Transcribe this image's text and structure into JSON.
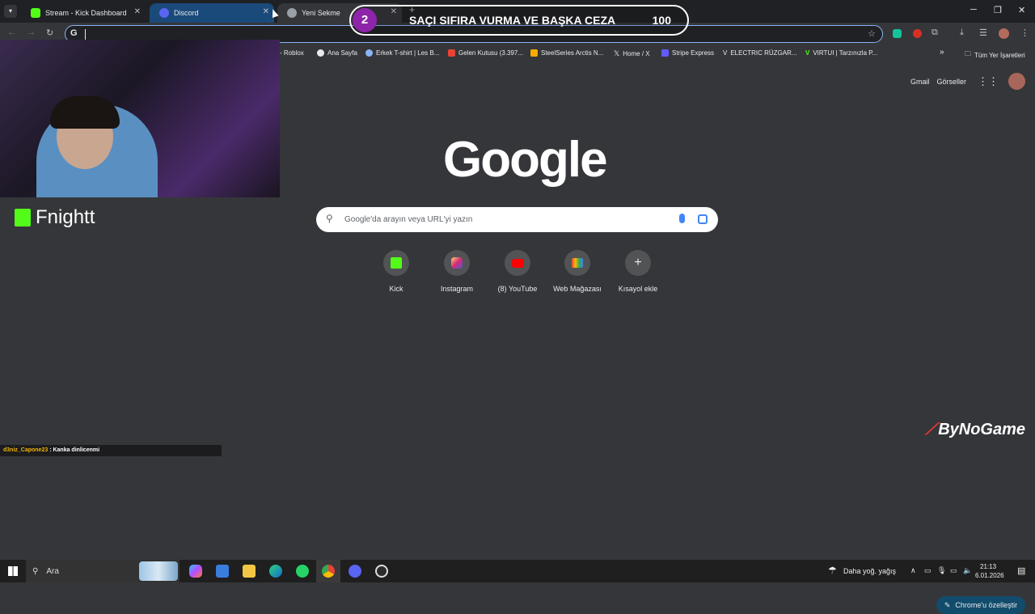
{
  "tabs": [
    {
      "label": "Stream - Kick Dashboard",
      "color": "#53fc18"
    },
    {
      "label": "Discord",
      "color": "#5865f2"
    },
    {
      "label": "Yeni Sekme",
      "color": "#9aa0a6"
    }
  ],
  "overlay": {
    "number": "2",
    "text": "SAÇI SIFIRA VURMA VE BAŞKA CEZA",
    "count": "100"
  },
  "bookmarks": [
    {
      "label": "- Roblox",
      "color": "#9aa0a6"
    },
    {
      "label": "Ana Sayfa",
      "color": "#e8eaed"
    },
    {
      "label": "Erkek T-shirt | Les B...",
      "color": "#8ab4f8"
    },
    {
      "label": "Gelen Kutusu (3.397...",
      "color": "#ea4335"
    },
    {
      "label": "SteelSeries Arctis N...",
      "color": "#f9ab00"
    },
    {
      "label": "Home / X",
      "color": "#ffffff"
    },
    {
      "label": "Stripe Express",
      "color": "#635bff"
    },
    {
      "label": "ELECTRIC RÜZGAR...",
      "color": "#000000"
    },
    {
      "label": "VIRTUI | Tarzınızla P...",
      "color": "#53fc18"
    }
  ],
  "all_bookmarks_label": "Tüm Yer İşaretleri",
  "top_links": {
    "gmail": "Gmail",
    "images": "Görseller"
  },
  "logo_text": "Google",
  "search": {
    "placeholder": "Google'da arayın veya URL'yi yazın"
  },
  "shortcuts": [
    {
      "label": "Kick",
      "color": "#53fc18"
    },
    {
      "label": "Instagram",
      "color": "#e1306c"
    },
    {
      "label": "(8) YouTube",
      "color": "#ff0000"
    },
    {
      "label": "Web Mağazası",
      "color": "#4285f4"
    },
    {
      "label": "Kısayol ekle",
      "color": "#e8eaed"
    }
  ],
  "streamer_name": "Fnightt",
  "sponsor": "ByNoGame",
  "chat": {
    "user": "d3niz_Capone23",
    "message": " : Kanka dinlicenmi"
  },
  "customize_label": "Chrome'u özelleştir",
  "taskbar": {
    "search_label": "Ara",
    "weather": "Daha yoğ. yağış",
    "time": "21:13",
    "date": "6.01.2026"
  }
}
